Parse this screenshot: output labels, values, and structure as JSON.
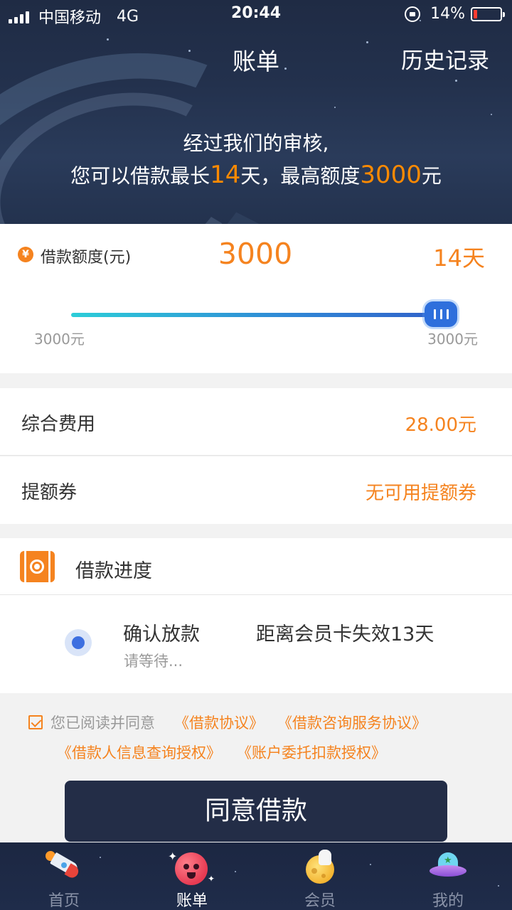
{
  "status_bar": {
    "carrier": "中国移动",
    "network": "4G",
    "time": "20:44",
    "battery": "14%",
    "battery_level": 0.14
  },
  "nav": {
    "title": "账单",
    "history": "历史记录"
  },
  "banner": {
    "line1": "经过我们的审核,",
    "line2_prefix": "您可以借款最长",
    "max_days": "14",
    "line2_mid": "天，最高额度",
    "max_amount": "3000",
    "line2_suffix": "元"
  },
  "loan": {
    "yen_symbol": "¥",
    "amount_label": "借款额度(元)",
    "amount": "3000",
    "days": "14天",
    "slider_min": "3000元",
    "slider_max": "3000元",
    "slider_position": 1.0
  },
  "fees": {
    "label": "综合费用",
    "value": "28.00元"
  },
  "coupon": {
    "label": "提额券",
    "value": "无可用提额券"
  },
  "progress": {
    "title": "借款进度",
    "step_title": "确认放款",
    "step_sub": "请等待...",
    "expire_text": "距离会员卡失效13天"
  },
  "agreement": {
    "checked": true,
    "text": "您已阅读并同意",
    "links": [
      "《借款协议》",
      "《借款咨询服务协议》",
      "《借款人信息查询授权》",
      "《账户委托扣款授权》"
    ]
  },
  "submit_label": "同意借款",
  "tabs": [
    {
      "label": "首页",
      "icon": "rocket-icon",
      "active": false
    },
    {
      "label": "账单",
      "icon": "planet-icon",
      "active": true
    },
    {
      "label": "会员",
      "icon": "moon-astronaut-icon",
      "active": false
    },
    {
      "label": "我的",
      "icon": "ufo-icon",
      "active": false
    }
  ],
  "colors": {
    "accent": "#f5831f",
    "dark_navy": "#232d47",
    "slider_start": "#2ccdd8",
    "slider_end": "#3161c9"
  }
}
